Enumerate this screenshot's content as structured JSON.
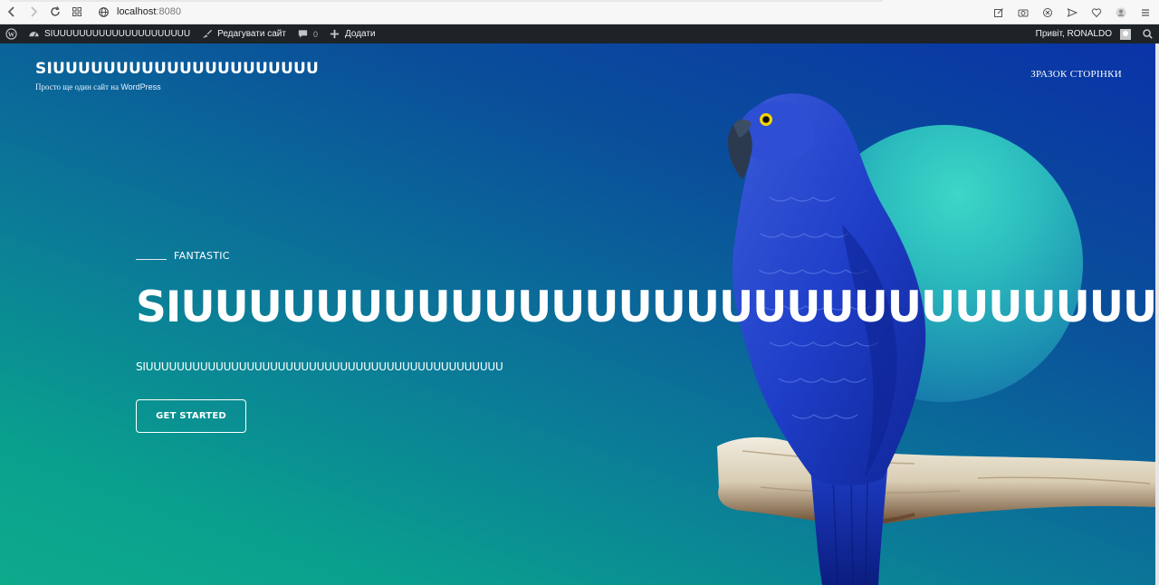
{
  "browser": {
    "url_host": "localhost",
    "url_port": ":8080"
  },
  "admin_bar": {
    "site_name": "SIUUUUUUUUUUUUUUUUUUUUU",
    "edit_label": "Редагувати сайт",
    "comments_count": "0",
    "new_label": "Додати",
    "greeting": "Привіт, RONALDO"
  },
  "site": {
    "title": "SIUUUUUUUUUUUUUUUUUUUUU",
    "tagline_prefix": "Просто ще один сайт на ",
    "tagline_brand": "WordPress",
    "nav_item": "ЗРАЗОК СТОРІНКИ"
  },
  "hero": {
    "eyebrow": "FANTASTIC",
    "headline": "SIUUUUUUUUUUUUUUUUUUUUUUUUUUUUU",
    "subheadline": "SIUUUUUUUUUUUUUUUUUUUUUUUUUUUUUUUUUUUUUUUUUUUUUU",
    "cta_label": "GET STARTED"
  },
  "colors": {
    "admin_bar_bg": "#1d2327",
    "hero_top": "#0a33a8",
    "hero_bottom": "#0aa08e",
    "accent_circle": "#3dd6c7"
  }
}
